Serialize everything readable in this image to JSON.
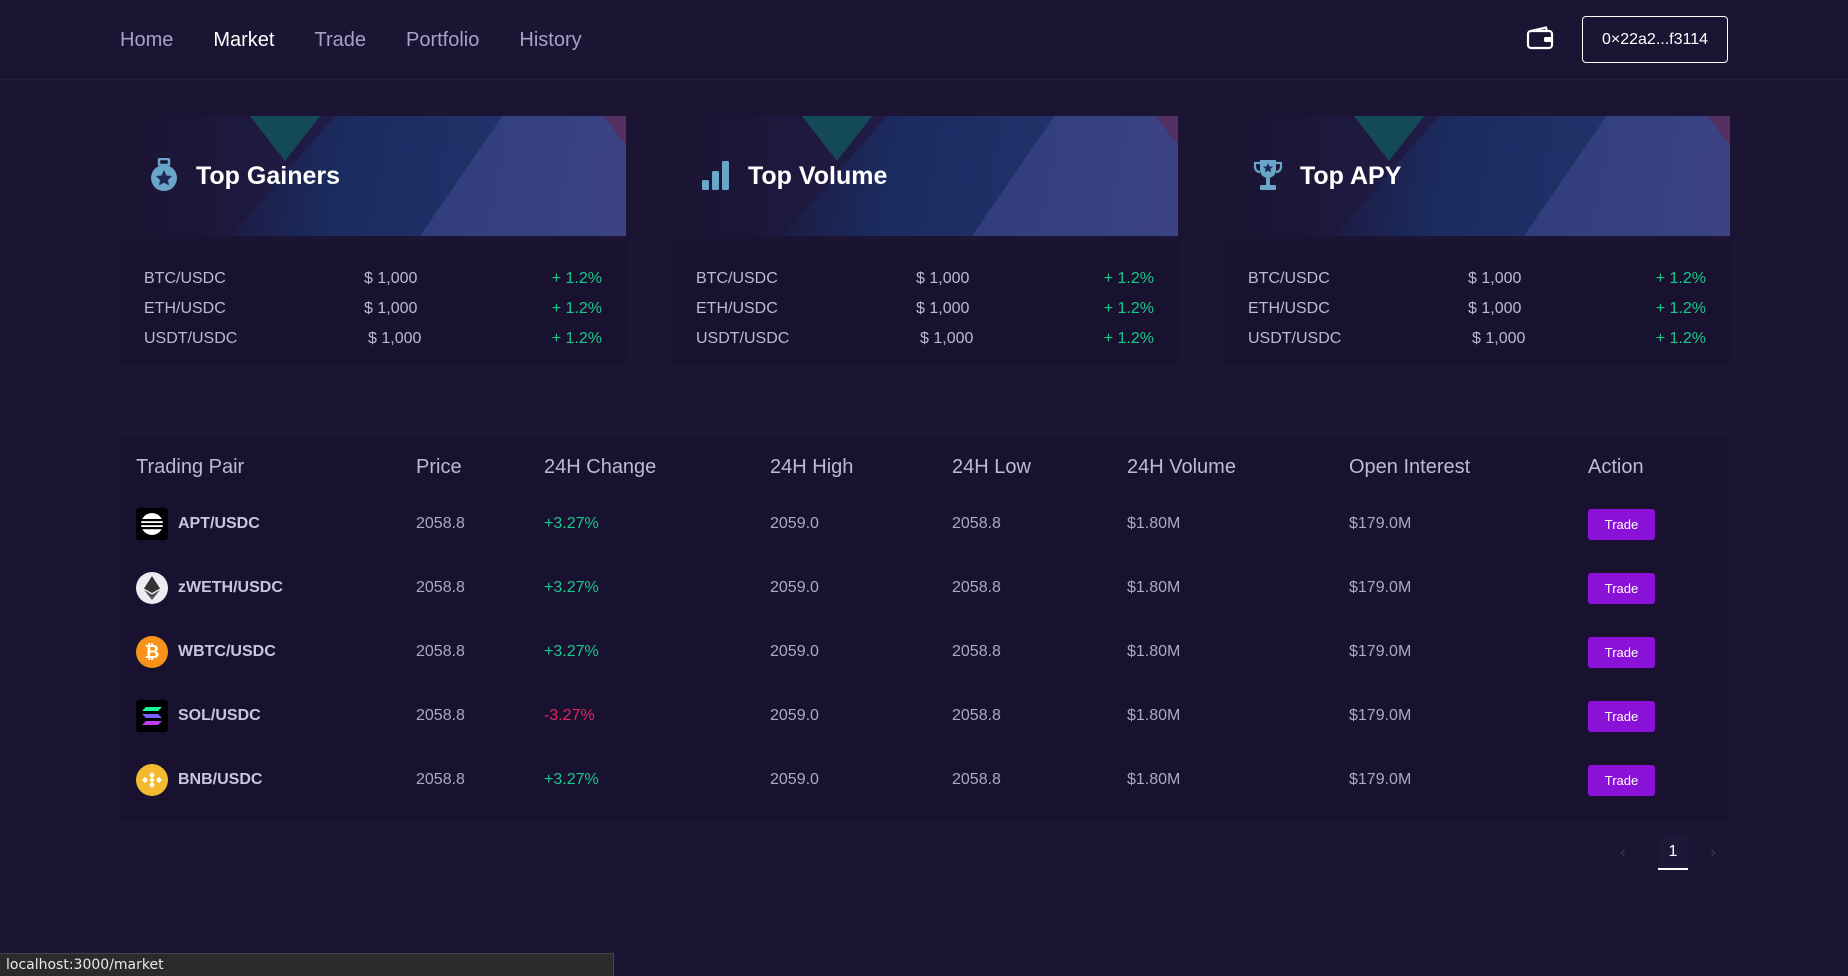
{
  "nav": {
    "items": [
      {
        "label": "Home",
        "active": false
      },
      {
        "label": "Market",
        "active": true
      },
      {
        "label": "Trade",
        "active": false
      },
      {
        "label": "Portfolio",
        "active": false
      },
      {
        "label": "History",
        "active": false
      }
    ],
    "wallet_icon": "wallet-icon",
    "address": "0×22a2...f3114"
  },
  "cards": [
    {
      "title": "Top Gainers",
      "icon": "medal-icon",
      "rows": [
        {
          "pair": "BTC/USDC",
          "price": "$ 1,000",
          "change": "+ 1.2%"
        },
        {
          "pair": "ETH/USDC",
          "price": "$ 1,000",
          "change": "+ 1.2%"
        },
        {
          "pair": "USDT/USDC",
          "price": "$ 1,000",
          "change": "+ 1.2%"
        }
      ]
    },
    {
      "title": "Top Volume",
      "icon": "bar-chart-icon",
      "rows": [
        {
          "pair": "BTC/USDC",
          "price": "$ 1,000",
          "change": "+ 1.2%"
        },
        {
          "pair": "ETH/USDC",
          "price": "$ 1,000",
          "change": "+ 1.2%"
        },
        {
          "pair": "USDT/USDC",
          "price": "$ 1,000",
          "change": "+ 1.2%"
        }
      ]
    },
    {
      "title": "Top APY",
      "icon": "trophy-icon",
      "rows": [
        {
          "pair": "BTC/USDC",
          "price": "$ 1,000",
          "change": "+ 1.2%"
        },
        {
          "pair": "ETH/USDC",
          "price": "$ 1,000",
          "change": "+ 1.2%"
        },
        {
          "pair": "USDT/USDC",
          "price": "$ 1,000",
          "change": "+ 1.2%"
        }
      ]
    }
  ],
  "table": {
    "headers": [
      "Trading Pair",
      "Price",
      "24H Change",
      "24H High",
      "24H Low",
      "24H Volume",
      "Open Interest",
      "Action"
    ],
    "rows": [
      {
        "pair": "APT/USDC",
        "coin_icon": "apt-icon",
        "price": "2058.8",
        "change": "+3.27%",
        "direction": "up",
        "high": "2059.0",
        "low": "2058.8",
        "volume": "$1.80M",
        "oi": "$179.0M",
        "action": "Trade"
      },
      {
        "pair": "zWETH/USDC",
        "coin_icon": "eth-icon",
        "price": "2058.8",
        "change": "+3.27%",
        "direction": "up",
        "high": "2059.0",
        "low": "2058.8",
        "volume": "$1.80M",
        "oi": "$179.0M",
        "action": "Trade"
      },
      {
        "pair": "WBTC/USDC",
        "coin_icon": "btc-icon",
        "price": "2058.8",
        "change": "+3.27%",
        "direction": "up",
        "high": "2059.0",
        "low": "2058.8",
        "volume": "$1.80M",
        "oi": "$179.0M",
        "action": "Trade"
      },
      {
        "pair": "SOL/USDC",
        "coin_icon": "sol-icon",
        "price": "2058.8",
        "change": "-3.27%",
        "direction": "down",
        "high": "2059.0",
        "low": "2058.8",
        "volume": "$1.80M",
        "oi": "$179.0M",
        "action": "Trade"
      },
      {
        "pair": "BNB/USDC",
        "coin_icon": "bnb-icon",
        "price": "2058.8",
        "change": "+3.27%",
        "direction": "up",
        "high": "2059.0",
        "low": "2058.8",
        "volume": "$1.80M",
        "oi": "$179.0M",
        "action": "Trade"
      }
    ]
  },
  "pagination": {
    "current": "1",
    "prev_icon": "chevron-left-icon",
    "next_icon": "chevron-right-icon"
  },
  "status_url": "localhost:3000/market",
  "colors": {
    "background": "#1b1432",
    "positive": "#19c98a",
    "negative": "#e0245e",
    "trade_button": "#8a12d6"
  }
}
